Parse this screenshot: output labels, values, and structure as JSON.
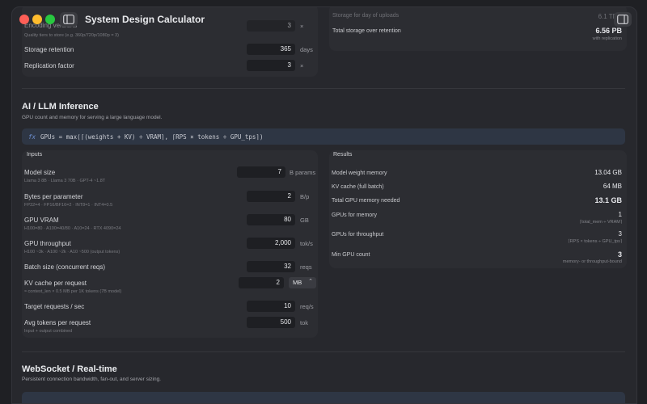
{
  "app": {
    "title": "System Design Calculator"
  },
  "video_section": {
    "encoding_label": "Encoding versions",
    "encoding_value": "3",
    "encoding_unit": "×",
    "encoding_hint": "Quality tiers to store (e.g. 360p/720p/1080p = 3)",
    "retention_label": "Storage retention",
    "retention_value": "365",
    "retention_unit": "days",
    "replication_label": "Replication factor",
    "replication_value": "3",
    "replication_unit": "×",
    "storage_per_day_label": "Storage for day of uploads",
    "storage_per_day_value": "6.1 TB",
    "total_storage_label": "Total storage over retention",
    "total_storage_value": "6.56 PB",
    "total_storage_hint": "with replication"
  },
  "ai_section": {
    "title": "AI / LLM Inference",
    "subtitle": "GPU count and memory for serving a large language model.",
    "formula_icon": "fx",
    "formula": "GPUs = max(⌈(weights + KV) ÷ VRAM⌉, ⌈RPS × tokens ÷ GPU_tps⌉)",
    "inputs_title": "Inputs",
    "results_title": "Results",
    "inputs": [
      {
        "label": "Model size",
        "value": "7",
        "unit": "B params",
        "hint": "Llama 3 8B · Llama 3 70B · GPT-4 ~1.8T"
      },
      {
        "label": "Bytes per parameter",
        "value": "2",
        "unit": "B/p",
        "hint": "FP32=4 · FP16/BF16=2 · INT8=1 · INT4=0.5"
      },
      {
        "label": "GPU VRAM",
        "value": "80",
        "unit": "GB",
        "hint": "H100=80 · A100=40/80 · A10=24 · RTX 4090=24"
      },
      {
        "label": "GPU throughput",
        "value": "2,000",
        "unit": "tok/s",
        "hint": "H100 ~3k · A100 ~2k · A10 ~500 (output tokens)"
      },
      {
        "label": "Batch size (concurrent reqs)",
        "value": "32",
        "unit": "reqs",
        "hint": ""
      },
      {
        "label": "KV cache per request",
        "value": "2",
        "unit": "MB",
        "hint": "≈ context_len × 0.5 MB per 1K tokens (7B model)"
      },
      {
        "label": "Target requests / sec",
        "value": "10",
        "unit": "req/s",
        "hint": ""
      },
      {
        "label": "Avg tokens per request",
        "value": "500",
        "unit": "tok",
        "hint": "Input + output combined"
      }
    ],
    "results": [
      {
        "label": "Model weight memory",
        "value": "13.04 GB",
        "hint": ""
      },
      {
        "label": "KV cache (full batch)",
        "value": "64 MB",
        "hint": ""
      },
      {
        "label": "Total GPU memory needed",
        "value": "13.1 GB",
        "hint": ""
      },
      {
        "label": "GPUs for memory",
        "value": "1",
        "hint": "⌈total_mem ÷ VRAM⌉"
      },
      {
        "label": "GPUs for throughput",
        "value": "3",
        "hint": "⌈RPS × tokens ÷ GPU_tps⌉"
      },
      {
        "label": "Min GPU count",
        "value": "3",
        "hint": "memory- or throughput-bound"
      }
    ]
  },
  "ws_section": {
    "title": "WebSocket / Real-time",
    "subtitle": "Persistent connection bandwidth, fan-out, and server sizing."
  }
}
